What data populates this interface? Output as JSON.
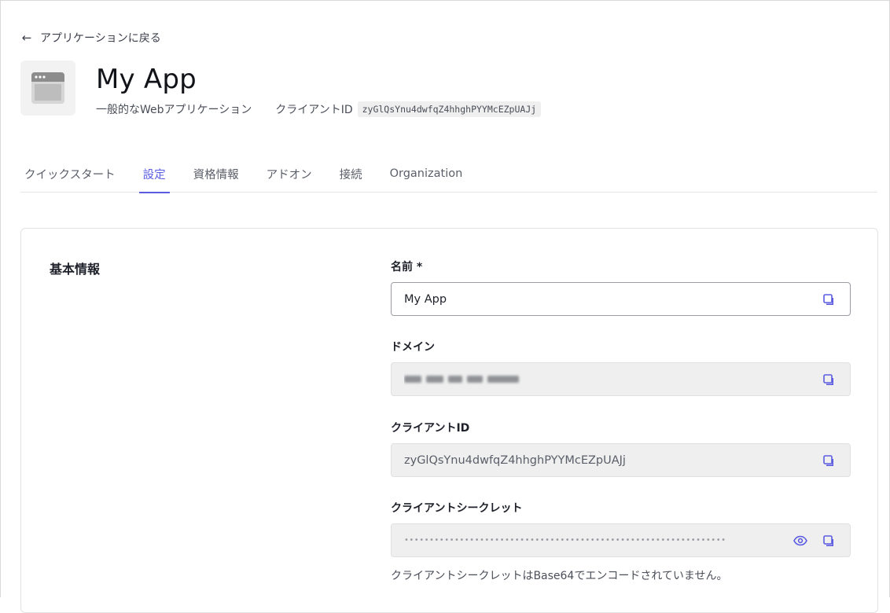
{
  "back": {
    "label": "アプリケーションに戻る"
  },
  "app": {
    "name": "My App",
    "type": "一般的なWebアプリケーション",
    "client_id_label": "クライアントID",
    "client_id": "zyGlQsYnu4dwfqZ4hhghPYYMcEZpUAJj"
  },
  "tabs": [
    {
      "label": "クイックスタート",
      "active": false
    },
    {
      "label": "設定",
      "active": true
    },
    {
      "label": "資格情報",
      "active": false
    },
    {
      "label": "アドオン",
      "active": false
    },
    {
      "label": "接続",
      "active": false
    },
    {
      "label": "Organization",
      "active": false
    }
  ],
  "basic_info": {
    "title": "基本情報",
    "name_label": "名前 *",
    "name_value": "My App",
    "domain_label": "ドメイン",
    "client_id_label": "クライアントID",
    "client_id_value": "zyGlQsYnu4dwfqZ4hhghPYYMcEZpUAJj",
    "client_secret_label": "クライアントシークレット",
    "client_secret_value": "••••••••••••••••••••••••••••••••••••••••••••••••••••••••••••••••",
    "client_secret_helper": "クライアントシークレットはBase64でエンコードされていません。"
  },
  "icons": {
    "back": "arrow-left-icon",
    "app": "browser-window-icon",
    "copy": "copy-icon",
    "reveal": "eye-icon"
  },
  "colors": {
    "accent": "#5b5ce2",
    "readonly_bg": "#efefef",
    "border": "#9b9da3"
  }
}
